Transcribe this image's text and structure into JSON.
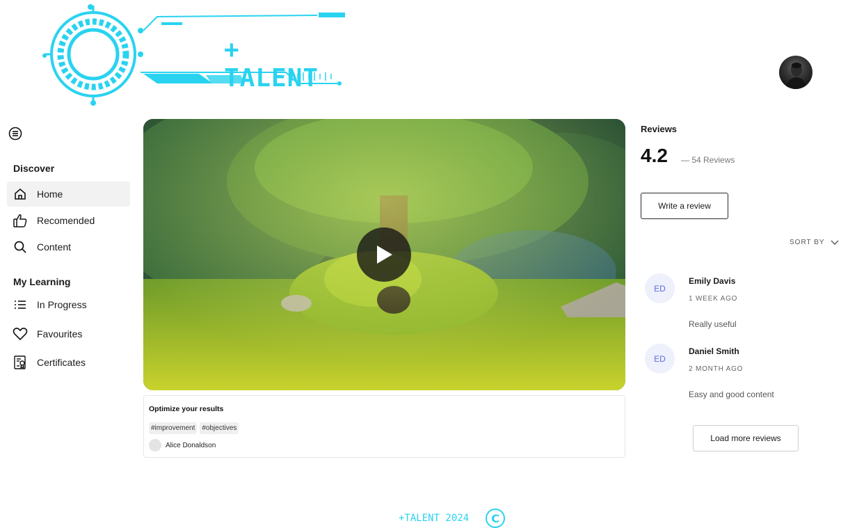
{
  "brand": {
    "logo_text": "+ TALENT",
    "accent_color": "#29d3f0"
  },
  "header": {
    "avatar_icon": "user-avatar"
  },
  "sidebar": {
    "menu_icon": "menu-icon",
    "sections": [
      {
        "title": "Discover",
        "items": [
          {
            "label": "Home",
            "icon": "home-icon",
            "active": true
          },
          {
            "label": "Recomended",
            "icon": "thumbs-up-icon",
            "active": false
          },
          {
            "label": "Content",
            "icon": "search-icon",
            "active": false
          }
        ]
      },
      {
        "title": "My Learning",
        "items": [
          {
            "label": "In Progress",
            "icon": "list-icon",
            "active": false
          },
          {
            "label": "Favourites",
            "icon": "heart-icon",
            "active": false
          },
          {
            "label": "Certificates",
            "icon": "certificate-icon",
            "active": false
          }
        ]
      }
    ]
  },
  "video": {
    "play_icon": "play-icon",
    "title": "Optimize your results",
    "tags": [
      "#improvement",
      "#objectives"
    ],
    "author": "Alice Donaldson"
  },
  "reviews": {
    "title": "Reviews",
    "rating": "4.2",
    "count_text": "— 54 Reviews",
    "write_label": "Write a review",
    "sort_label": "SORT BY",
    "items": [
      {
        "initials": "ED",
        "name": "Emily Davis",
        "time": "1 WEEK AGO",
        "text": "Really useful"
      },
      {
        "initials": "ED",
        "name": "Daniel Smith",
        "time": "2 MONTH AGO",
        "text": "Easy and good content"
      }
    ],
    "load_more_label": "Load more reviews"
  },
  "footer": {
    "text": "+TALENT 2024",
    "copyright_symbol": "C"
  }
}
